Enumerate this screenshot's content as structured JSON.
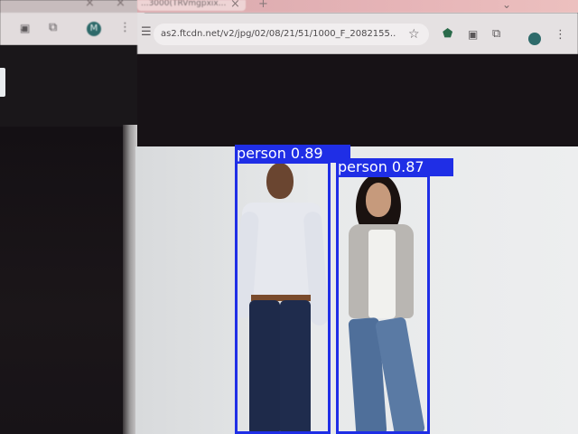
{
  "browser_left": {
    "toolbar_icons": [
      "chevron-down-icon",
      "close-icon",
      "camera-icon",
      "extension-icon"
    ],
    "avatar_letter": "M"
  },
  "browser_right": {
    "tab_title": "...3000(TRVmgpxix...",
    "url": "as2.ftcdn.net/v2/jpg/02/08/21/51/1000_F_2082155...",
    "toolbar_icons": [
      "tune-icon",
      "star-icon",
      "shield-icon",
      "camera-icon",
      "extension-icon",
      "avatar-icon",
      "more-icon"
    ]
  },
  "detections": [
    {
      "label": "person",
      "score": "0.89",
      "text": "person 0.89"
    },
    {
      "label": "person",
      "score": "0.87",
      "text": "person 0.87"
    }
  ],
  "colors": {
    "box": "#1f2ee6",
    "label_text": "#ffffff"
  }
}
